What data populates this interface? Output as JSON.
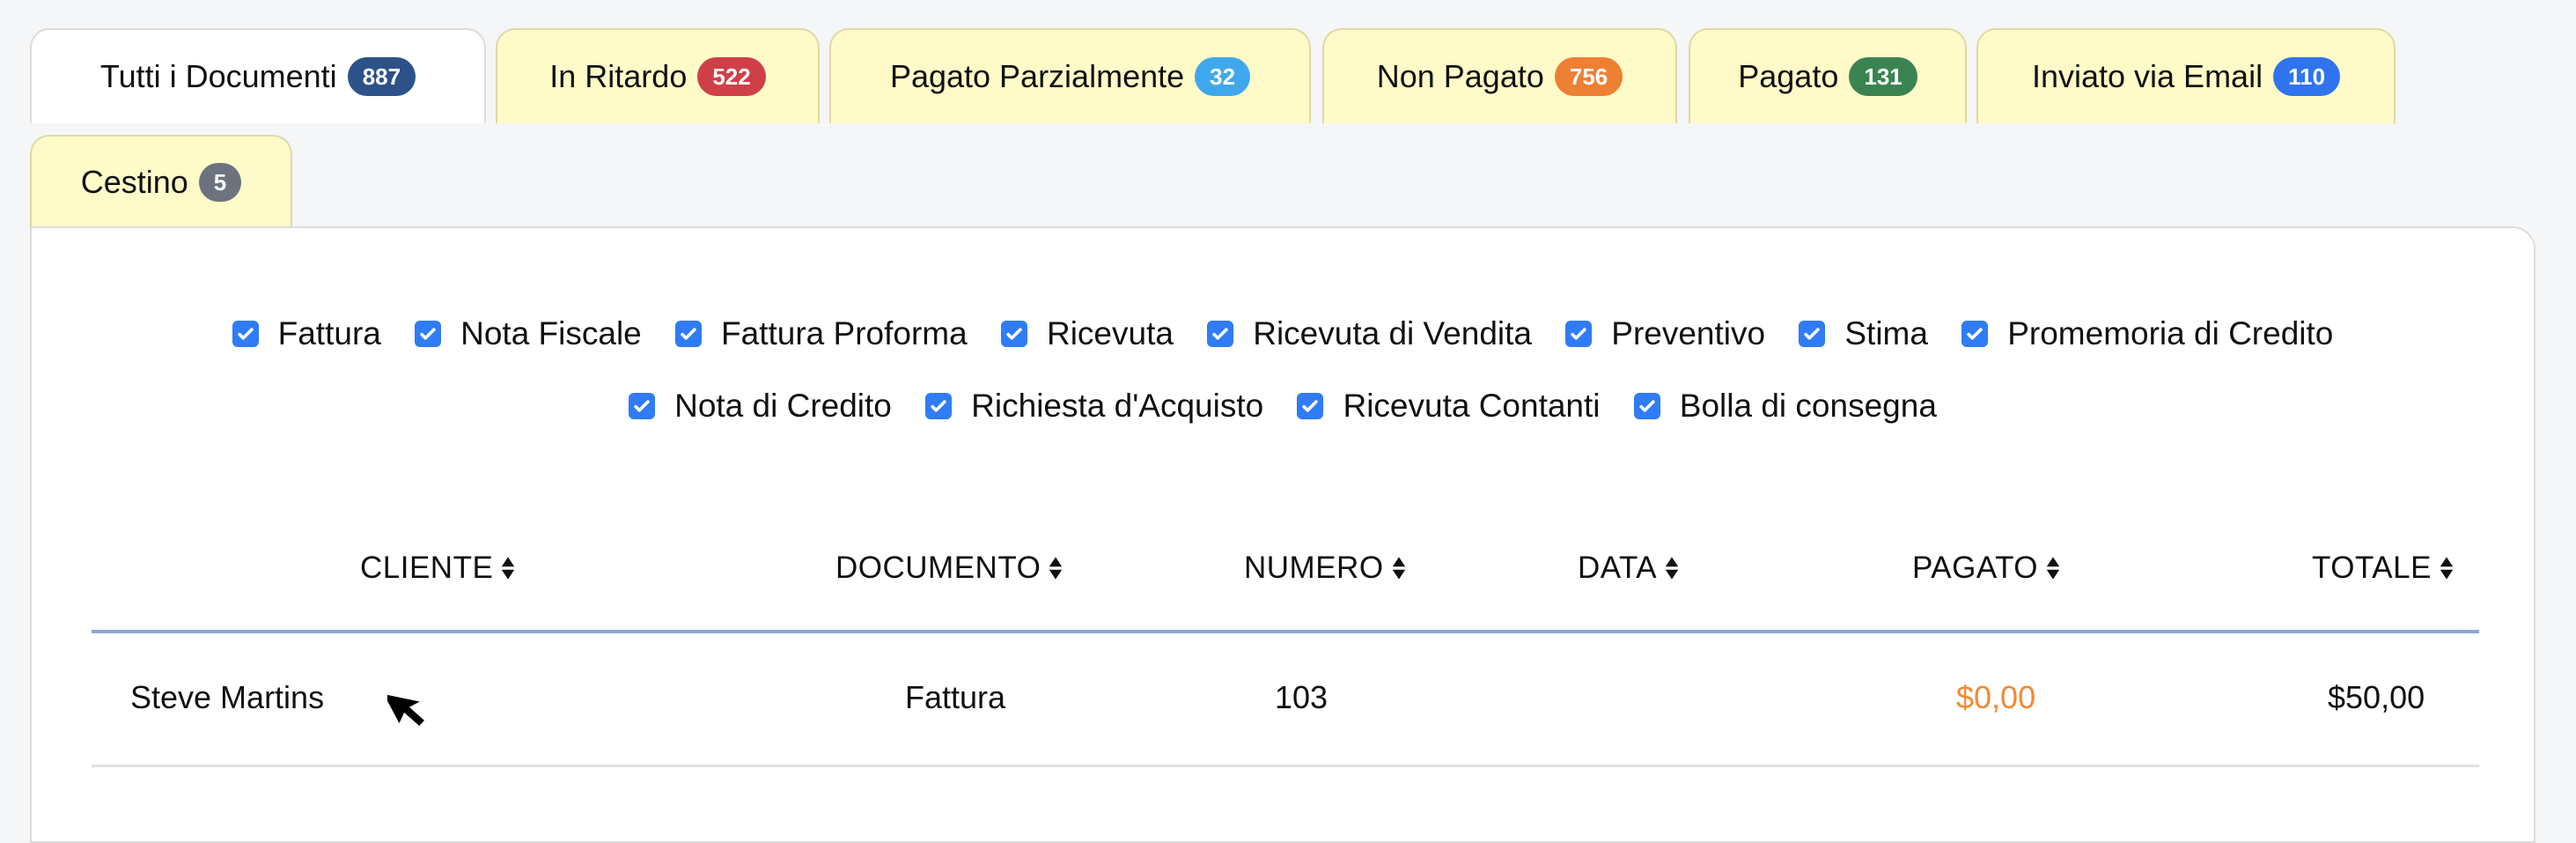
{
  "tabs": [
    {
      "label": "Tutti i Documenti",
      "count": "887",
      "color": "#2c5289",
      "active": true
    },
    {
      "label": "In Ritardo",
      "count": "522",
      "color": "#cf3f48"
    },
    {
      "label": "Pagato Parzialmente",
      "count": "32",
      "color": "#3fa8ec"
    },
    {
      "label": "Non Pagato",
      "count": "756",
      "color": "#ee8034"
    },
    {
      "label": "Pagato",
      "count": "131",
      "color": "#3b8452"
    },
    {
      "label": "Inviato via Email",
      "count": "110",
      "color": "#2f74ee"
    },
    {
      "label": "Cestino",
      "count": "5",
      "color": "#6c737e"
    }
  ],
  "filters": {
    "row1": [
      {
        "label": "Fattura",
        "checked": true
      },
      {
        "label": "Nota Fiscale",
        "checked": true
      },
      {
        "label": "Fattura Proforma",
        "checked": true
      },
      {
        "label": "Ricevuta",
        "checked": true
      },
      {
        "label": "Ricevuta di Vendita",
        "checked": true
      },
      {
        "label": "Preventivo",
        "checked": true
      },
      {
        "label": "Stima",
        "checked": true
      },
      {
        "label": "Promemoria di Credito",
        "checked": true
      }
    ],
    "row2": [
      {
        "label": "Nota di Credito",
        "checked": true
      },
      {
        "label": "Richiesta d'Acquisto",
        "checked": true
      },
      {
        "label": "Ricevuta Contanti",
        "checked": true
      },
      {
        "label": "Bolla di consegna",
        "checked": true
      }
    ]
  },
  "table": {
    "columns": [
      "CLIENTE",
      "DOCUMENTO",
      "NUMERO",
      "DATA",
      "PAGATO",
      "TOTALE"
    ],
    "rows": [
      {
        "cliente": "Steve Martins",
        "documento": "Fattura",
        "numero": "103",
        "data": "",
        "pagato": "$0,00",
        "totale": "$50,00"
      }
    ]
  },
  "colors": {
    "paid_zero": "#f08a33",
    "checkbox": "#2f7cf6",
    "tab_bg": "#fefbc8"
  }
}
